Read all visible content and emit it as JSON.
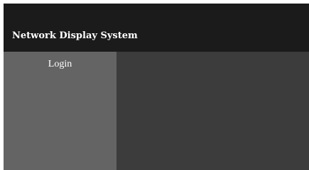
{
  "header": {
    "title": "Network Display System"
  },
  "sidebar": {
    "items": [
      {
        "label": "Login"
      }
    ]
  },
  "colors": {
    "header_bg": "#1b1b1b",
    "sidebar_bg": "#646464",
    "main_bg": "#3c3c3c",
    "text": "#ffffff"
  }
}
